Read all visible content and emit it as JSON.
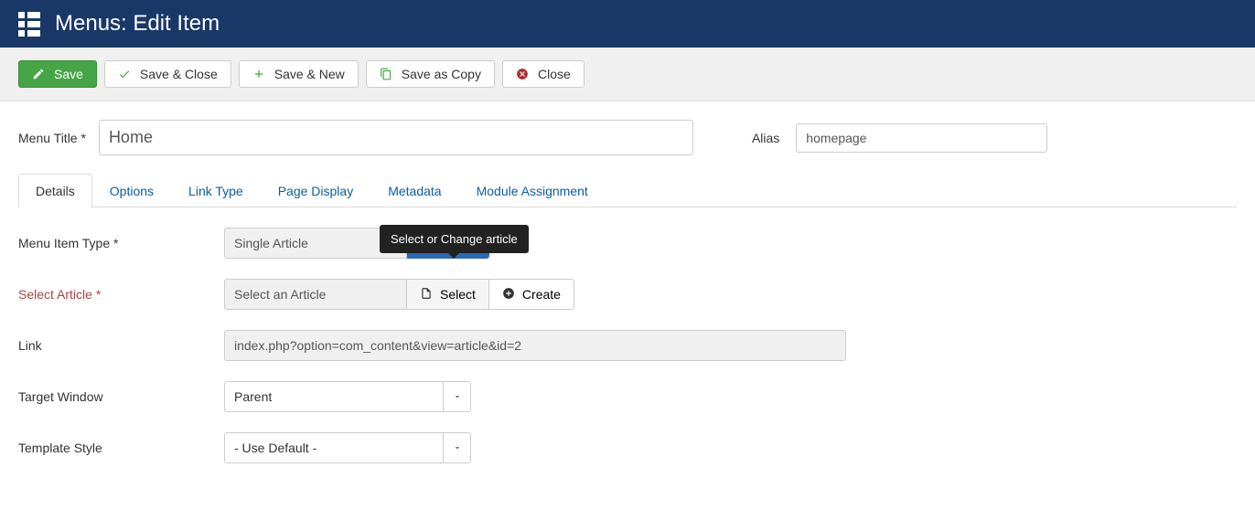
{
  "header": {
    "title": "Menus: Edit Item"
  },
  "toolbar": {
    "save": "Save",
    "save_close": "Save & Close",
    "save_new": "Save & New",
    "save_copy": "Save as Copy",
    "close": "Close"
  },
  "form": {
    "menu_title_label": "Menu Title *",
    "menu_title_value": "Home",
    "alias_label": "Alias",
    "alias_value": "homepage"
  },
  "tabs": [
    {
      "label": "Details",
      "active": true
    },
    {
      "label": "Options",
      "active": false
    },
    {
      "label": "Link Type",
      "active": false
    },
    {
      "label": "Page Display",
      "active": false
    },
    {
      "label": "Metadata",
      "active": false
    },
    {
      "label": "Module Assignment",
      "active": false
    }
  ],
  "details": {
    "menu_item_type_label": "Menu Item Type *",
    "menu_item_type_value": "Single Article",
    "menu_item_type_button": "Select",
    "select_article_label": "Select Article *",
    "select_article_value": "Select an Article",
    "select_button": "Select",
    "create_button": "Create",
    "tooltip": "Select or Change article",
    "link_label": "Link",
    "link_value": "index.php?option=com_content&view=article&id=2",
    "target_window_label": "Target Window",
    "target_window_value": "Parent",
    "template_style_label": "Template Style",
    "template_style_value": "- Use Default -"
  }
}
